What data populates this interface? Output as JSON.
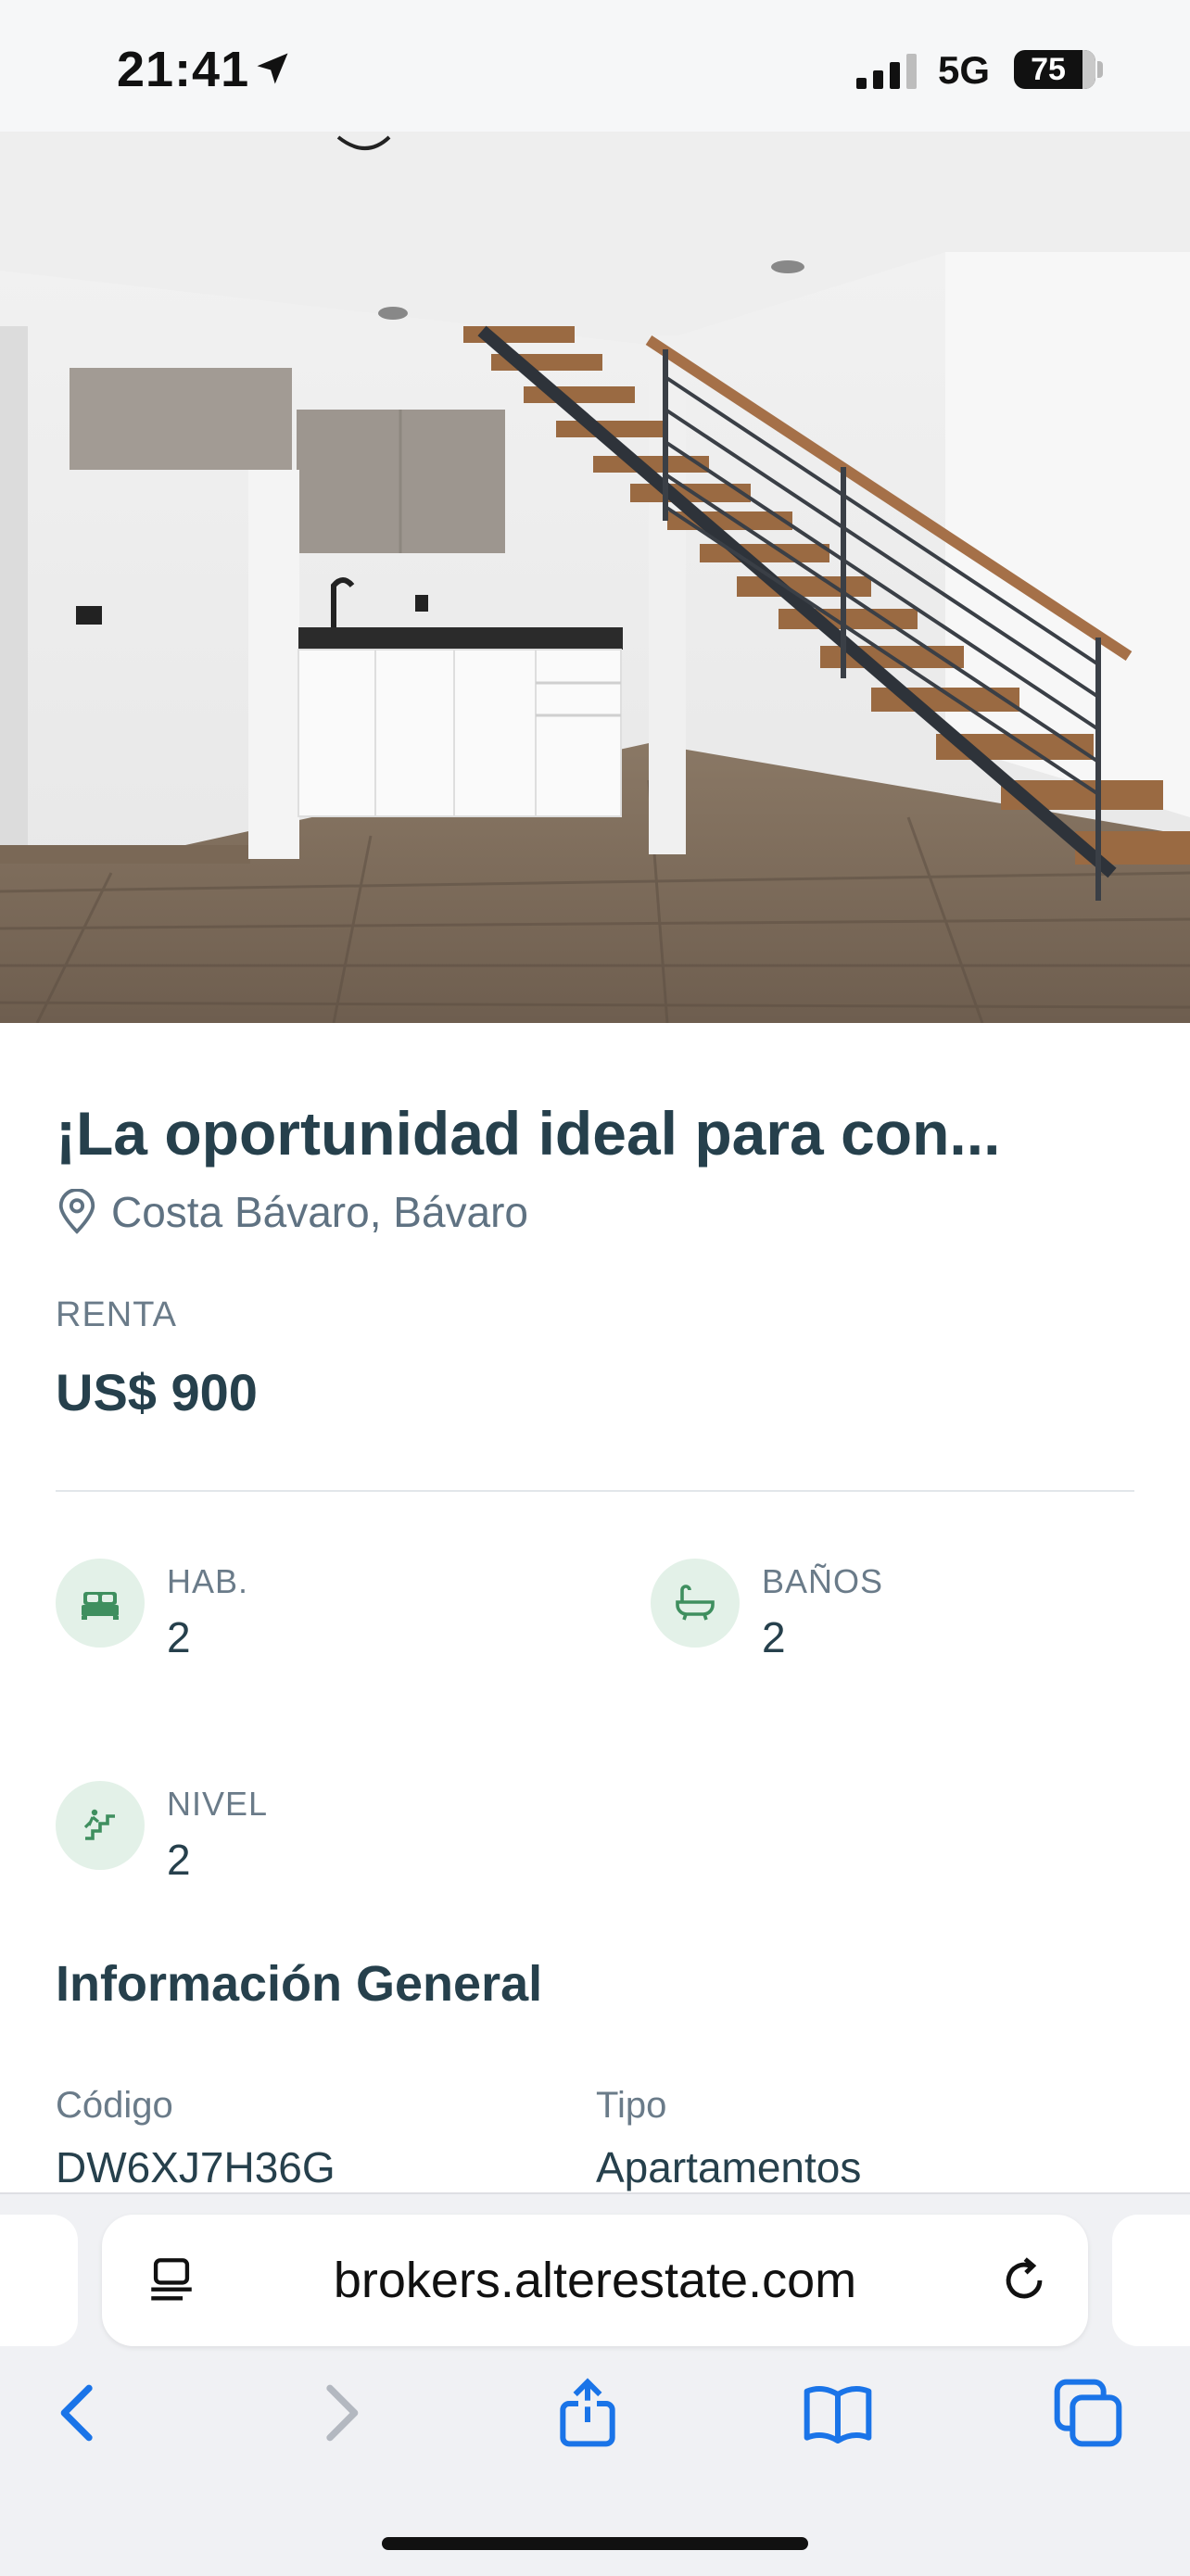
{
  "status_bar": {
    "time": "21:41",
    "network": "5G",
    "battery": "75",
    "icons": [
      "location-arrow-icon",
      "cellular-signal-icon",
      "battery-icon"
    ]
  },
  "listing": {
    "title": "¡La oportunidad ideal para con...",
    "location": "Costa Bávaro, Bávaro",
    "price_label": "RENTA",
    "price": "US$ 900",
    "features": [
      {
        "label": "HAB.",
        "value": "2",
        "icon": "bed-icon"
      },
      {
        "label": "BAÑOS",
        "value": "2",
        "icon": "bathtub-icon"
      },
      {
        "label": "NIVEL",
        "value": "2",
        "icon": "stairs-icon"
      }
    ],
    "general_info": {
      "title": "Información General",
      "items": [
        {
          "label": "Código",
          "value": "DW6XJ7H36G"
        },
        {
          "label": "Tipo",
          "value": "Apartamentos"
        }
      ]
    }
  },
  "browser": {
    "url": "brokers.alterestate.com",
    "icons": [
      "reader-icon",
      "reload-icon",
      "back-icon",
      "forward-icon",
      "share-icon",
      "bookmarks-icon",
      "tabs-icon"
    ]
  },
  "colors": {
    "heading": "#26404c",
    "muted": "#6a7b89",
    "icon_green": "#3f8f5f",
    "icon_bg": "#e3f1e8",
    "browser_blue": "#1a74e8"
  }
}
